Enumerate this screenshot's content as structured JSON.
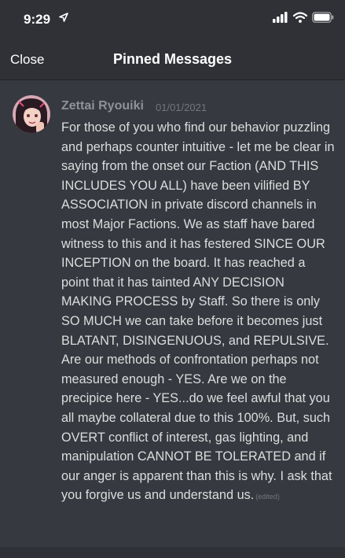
{
  "status_bar": {
    "time": "9:29"
  },
  "header": {
    "close_label": "Close",
    "title": "Pinned Messages"
  },
  "message": {
    "author": "Zettai Ryouiki",
    "timestamp": "01/01/2021",
    "text": "For those of you who find our behavior puzzling and perhaps counter intuitive - let me be clear in saying from the onset our Faction (AND THIS INCLUDES YOU ALL) have been vilified BY ASSOCIATION in private discord channels in most Major Factions. We as staff have bared witness to this and it has festered SINCE OUR INCEPTION on the board. It has reached a point that it has tainted ANY DECISION MAKING PROCESS by Staff. So there is only SO MUCH we can take before it becomes just BLATANT, DISINGENUOUS, and REPULSIVE. Are our methods of confrontation perhaps not measured enough - YES. Are we on the precipice here - YES...do we feel awful that you all maybe collateral due to this 100%. But, such OVERT conflict of interest, gas lighting, and manipulation CANNOT BE TOLERATED and if our anger is apparent than this is why. I ask that you forgive us and understand us.",
    "edited_label": "(edited)"
  }
}
